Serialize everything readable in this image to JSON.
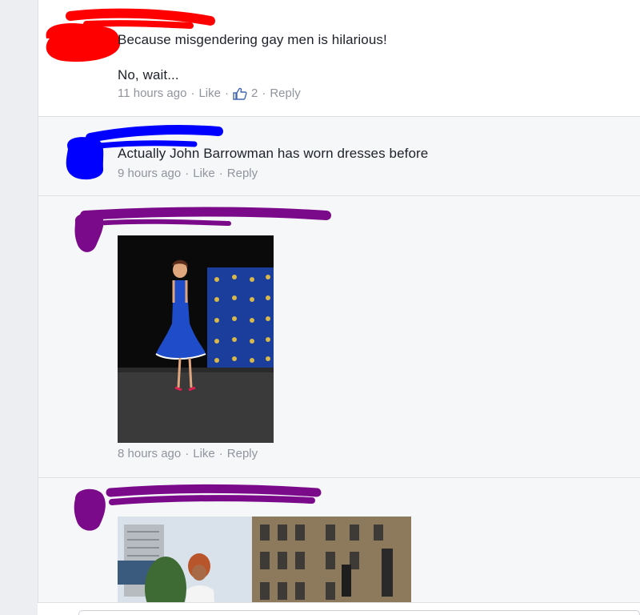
{
  "comments": [
    {
      "lines": [
        "Because misgendering gay men is hilarious!",
        "No, wait..."
      ],
      "time": "11 hours ago",
      "like_label": "Like",
      "like_count": "2",
      "reply_label": "Reply",
      "scribble_color": "#ff0000"
    },
    {
      "lines": [
        "Actually John Barrowman has worn dresses before"
      ],
      "time": "9 hours ago",
      "like_label": "Like",
      "reply_label": "Reply",
      "scribble_color": "#0000ff"
    },
    {
      "time": "8 hours ago",
      "like_label": "Like",
      "reply_label": "Reply",
      "scribble_color": "#7b0a8a",
      "photo_desc": "person in blue dress on stage"
    },
    {
      "scribble_color": "#7b0a8a",
      "photo_desc": "person in white outfit on street"
    }
  ],
  "separator": "·",
  "icons": {
    "like": "thumbs-up-icon"
  },
  "colors": {
    "meta": "#90949c",
    "text": "#1d2129",
    "like_blue": "#4267b2"
  }
}
